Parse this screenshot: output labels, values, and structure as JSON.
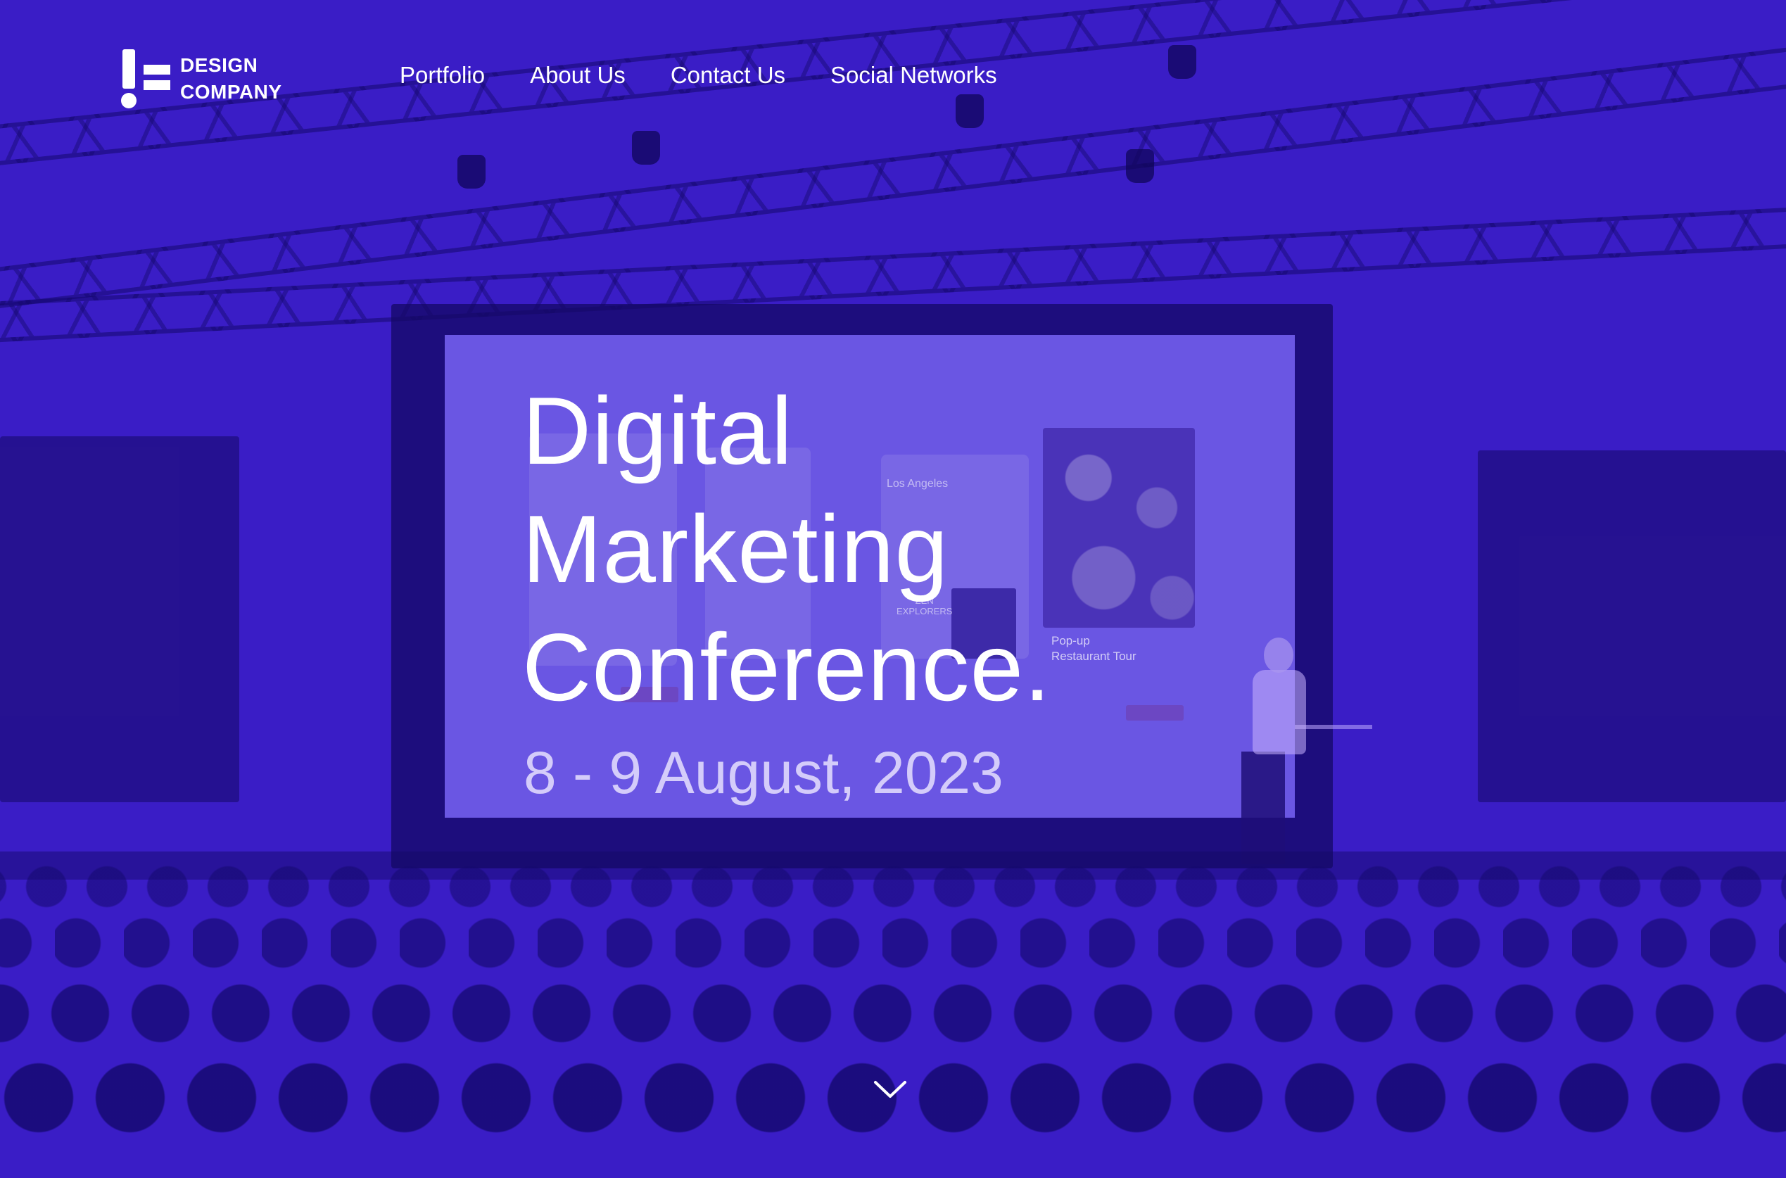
{
  "colors": {
    "overlay": "#3a1dc6",
    "screen": "#6a56e3",
    "text": "#ffffff"
  },
  "logo": {
    "line1": "DESIGN",
    "line2": "COMPANY"
  },
  "nav": [
    {
      "label": "Portfolio"
    },
    {
      "label": "About Us"
    },
    {
      "label": "Contact Us"
    },
    {
      "label": "Social Networks"
    }
  ],
  "hero": {
    "title_lines": [
      "Digital",
      "Marketing",
      "Conference."
    ],
    "date": "8 - 9 August, 2023"
  },
  "projected_screen": {
    "city": "Los Angeles",
    "event_line1": "Pop-up",
    "event_line2": "Restaurant Tour",
    "thumb_line1": "ZEN",
    "thumb_line2": "EXPLORERS"
  },
  "icons": {
    "scroll": "chevron-down-icon"
  }
}
